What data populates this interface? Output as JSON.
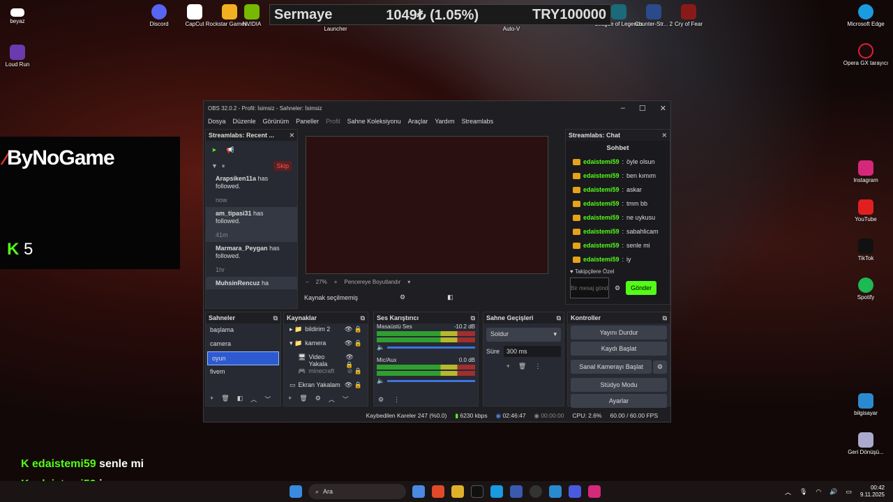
{
  "desktop": {
    "icons_left": [
      "beyaz",
      "Loud Run"
    ],
    "icons_top": [
      "Discord",
      "CapCut",
      "Rockstar Games ...",
      "NVIDIA",
      "Launcher",
      "Auto-V",
      "League of Legends",
      "Counter-Str... 2",
      "Cry of Fear"
    ],
    "icons_right": [
      "Microsoft Edge",
      "Opera GX tarayıcı",
      "Instagram",
      "YouTube",
      "TikTok",
      "Spotify",
      "bilgisayar",
      "Geri Dönüşü..."
    ]
  },
  "ticker": {
    "label": "Sermaye",
    "value": "1049₺ (1.05%)",
    "target": "TRY100000"
  },
  "overlay": {
    "brand": "ByNoGame",
    "kick_count": "5",
    "chat": [
      {
        "user": "edaistemi59",
        "msg": "senle mi"
      },
      {
        "user": "edaistemi59",
        "msg": "iy"
      }
    ]
  },
  "obs": {
    "title": "OBS 32.0.2 - Profil: İsimsiz - Sahneler: İsimsiz",
    "menu": [
      "Dosya",
      "Düzenle",
      "Görünüm",
      "Paneller",
      "Profil",
      "Sahne Koleksiyonu",
      "Araçlar",
      "Yardım",
      "Streamlabs"
    ],
    "recent": {
      "title": "Streamlabs: Recent ...",
      "skip": "Skip",
      "events": [
        {
          "user": "Arapsiken11a",
          "text": "has followed.",
          "time": "now"
        },
        {
          "user": "am_tipasi31",
          "text": "has followed.",
          "time": "41m"
        },
        {
          "user": "Marmara_Peygan",
          "text": "has followed.",
          "time": "1hr"
        },
        {
          "user": "MuhsinRencuz",
          "text": "ha"
        }
      ]
    },
    "preview": {
      "zoom": "27%",
      "fit": "Pencereye Boyutlandır",
      "no_source": "Kaynak seçilmemiş"
    },
    "chat": {
      "title": "Streamlabs: Chat",
      "tab": "Sohbet",
      "lines": [
        {
          "user": "edaistemi59",
          "msg": "öyle olsun"
        },
        {
          "user": "edaistemi59",
          "msg": "ben kımım"
        },
        {
          "user": "edaistemi59",
          "msg": "askar"
        },
        {
          "user": "edaistemi59",
          "msg": "tmm bb"
        },
        {
          "user": "edaistemi59",
          "msg": "ne uykusu"
        },
        {
          "user": "edaistemi59",
          "msg": "sabahlicam"
        },
        {
          "user": "edaistemi59",
          "msg": "senle mi"
        },
        {
          "user": "edaistemi59",
          "msg": "iy"
        }
      ],
      "followers": "Takipçilere Özel",
      "placeholder": "Bir mesaj gönderin",
      "send": "Gönder"
    },
    "scenes": {
      "title": "Sahneler",
      "items": [
        "başlama",
        "camera",
        "oyun",
        "fivem"
      ]
    },
    "sources": {
      "title": "Kaynaklar",
      "items": [
        "bildirim 2",
        "kamera",
        "Video Yakala",
        "minecraft",
        "Ekran Yakalam"
      ]
    },
    "mixer": {
      "title": "Ses Karıştırıcı",
      "channels": [
        {
          "name": "Masaüstü Ses",
          "db": "-10.2 dB"
        },
        {
          "name": "Mic/Aux",
          "db": "0.0 dB"
        }
      ]
    },
    "transitions": {
      "title": "Sahne Geçişleri",
      "type": "Soldur",
      "duration_label": "Süre",
      "duration": "300 ms"
    },
    "controls": {
      "title": "Kontroller",
      "buttons": [
        "Yayını Durdur",
        "Kaydı Başlat",
        "Sanal Kamerayı Başlat",
        "Stüdyo Modu",
        "Ayarlar"
      ]
    },
    "status": {
      "dropped": "Kaybedilen Kareler 247 (%0.0)",
      "bitrate": "6230 kbps",
      "live_time": "02:46:47",
      "rec_time": "00:00:00",
      "cpu": "CPU: 2.6%",
      "fps": "60.00 / 60.00 FPS"
    }
  },
  "taskbar": {
    "search": "Ara",
    "time": "00:42",
    "date": "9.11.2025"
  }
}
